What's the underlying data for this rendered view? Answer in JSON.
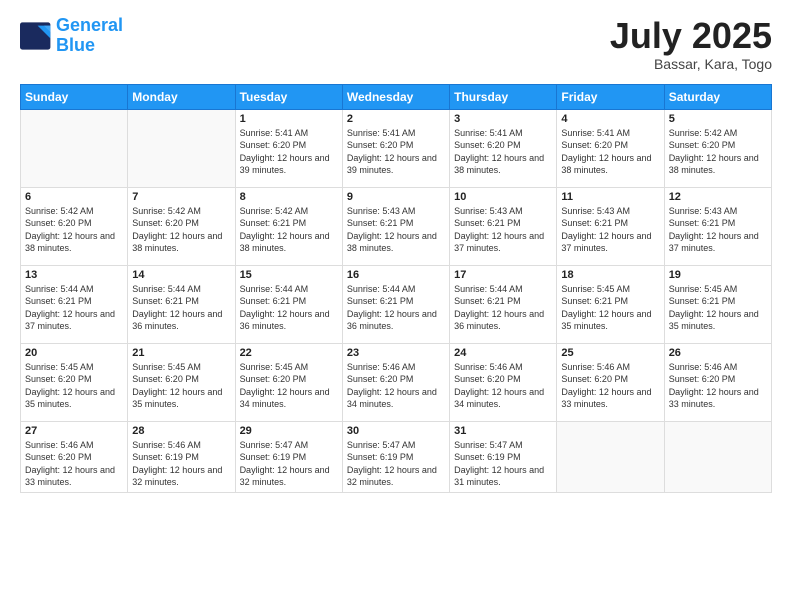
{
  "logo": {
    "line1": "General",
    "line2": "Blue"
  },
  "header": {
    "month": "July 2025",
    "location": "Bassar, Kara, Togo"
  },
  "weekdays": [
    "Sunday",
    "Monday",
    "Tuesday",
    "Wednesday",
    "Thursday",
    "Friday",
    "Saturday"
  ],
  "weeks": [
    [
      {
        "day": "",
        "info": ""
      },
      {
        "day": "",
        "info": ""
      },
      {
        "day": "1",
        "info": "Sunrise: 5:41 AM\nSunset: 6:20 PM\nDaylight: 12 hours and 39 minutes."
      },
      {
        "day": "2",
        "info": "Sunrise: 5:41 AM\nSunset: 6:20 PM\nDaylight: 12 hours and 39 minutes."
      },
      {
        "day": "3",
        "info": "Sunrise: 5:41 AM\nSunset: 6:20 PM\nDaylight: 12 hours and 38 minutes."
      },
      {
        "day": "4",
        "info": "Sunrise: 5:41 AM\nSunset: 6:20 PM\nDaylight: 12 hours and 38 minutes."
      },
      {
        "day": "5",
        "info": "Sunrise: 5:42 AM\nSunset: 6:20 PM\nDaylight: 12 hours and 38 minutes."
      }
    ],
    [
      {
        "day": "6",
        "info": "Sunrise: 5:42 AM\nSunset: 6:20 PM\nDaylight: 12 hours and 38 minutes."
      },
      {
        "day": "7",
        "info": "Sunrise: 5:42 AM\nSunset: 6:20 PM\nDaylight: 12 hours and 38 minutes."
      },
      {
        "day": "8",
        "info": "Sunrise: 5:42 AM\nSunset: 6:21 PM\nDaylight: 12 hours and 38 minutes."
      },
      {
        "day": "9",
        "info": "Sunrise: 5:43 AM\nSunset: 6:21 PM\nDaylight: 12 hours and 38 minutes."
      },
      {
        "day": "10",
        "info": "Sunrise: 5:43 AM\nSunset: 6:21 PM\nDaylight: 12 hours and 37 minutes."
      },
      {
        "day": "11",
        "info": "Sunrise: 5:43 AM\nSunset: 6:21 PM\nDaylight: 12 hours and 37 minutes."
      },
      {
        "day": "12",
        "info": "Sunrise: 5:43 AM\nSunset: 6:21 PM\nDaylight: 12 hours and 37 minutes."
      }
    ],
    [
      {
        "day": "13",
        "info": "Sunrise: 5:44 AM\nSunset: 6:21 PM\nDaylight: 12 hours and 37 minutes."
      },
      {
        "day": "14",
        "info": "Sunrise: 5:44 AM\nSunset: 6:21 PM\nDaylight: 12 hours and 36 minutes."
      },
      {
        "day": "15",
        "info": "Sunrise: 5:44 AM\nSunset: 6:21 PM\nDaylight: 12 hours and 36 minutes."
      },
      {
        "day": "16",
        "info": "Sunrise: 5:44 AM\nSunset: 6:21 PM\nDaylight: 12 hours and 36 minutes."
      },
      {
        "day": "17",
        "info": "Sunrise: 5:44 AM\nSunset: 6:21 PM\nDaylight: 12 hours and 36 minutes."
      },
      {
        "day": "18",
        "info": "Sunrise: 5:45 AM\nSunset: 6:21 PM\nDaylight: 12 hours and 35 minutes."
      },
      {
        "day": "19",
        "info": "Sunrise: 5:45 AM\nSunset: 6:21 PM\nDaylight: 12 hours and 35 minutes."
      }
    ],
    [
      {
        "day": "20",
        "info": "Sunrise: 5:45 AM\nSunset: 6:20 PM\nDaylight: 12 hours and 35 minutes."
      },
      {
        "day": "21",
        "info": "Sunrise: 5:45 AM\nSunset: 6:20 PM\nDaylight: 12 hours and 35 minutes."
      },
      {
        "day": "22",
        "info": "Sunrise: 5:45 AM\nSunset: 6:20 PM\nDaylight: 12 hours and 34 minutes."
      },
      {
        "day": "23",
        "info": "Sunrise: 5:46 AM\nSunset: 6:20 PM\nDaylight: 12 hours and 34 minutes."
      },
      {
        "day": "24",
        "info": "Sunrise: 5:46 AM\nSunset: 6:20 PM\nDaylight: 12 hours and 34 minutes."
      },
      {
        "day": "25",
        "info": "Sunrise: 5:46 AM\nSunset: 6:20 PM\nDaylight: 12 hours and 33 minutes."
      },
      {
        "day": "26",
        "info": "Sunrise: 5:46 AM\nSunset: 6:20 PM\nDaylight: 12 hours and 33 minutes."
      }
    ],
    [
      {
        "day": "27",
        "info": "Sunrise: 5:46 AM\nSunset: 6:20 PM\nDaylight: 12 hours and 33 minutes."
      },
      {
        "day": "28",
        "info": "Sunrise: 5:46 AM\nSunset: 6:19 PM\nDaylight: 12 hours and 32 minutes."
      },
      {
        "day": "29",
        "info": "Sunrise: 5:47 AM\nSunset: 6:19 PM\nDaylight: 12 hours and 32 minutes."
      },
      {
        "day": "30",
        "info": "Sunrise: 5:47 AM\nSunset: 6:19 PM\nDaylight: 12 hours and 32 minutes."
      },
      {
        "day": "31",
        "info": "Sunrise: 5:47 AM\nSunset: 6:19 PM\nDaylight: 12 hours and 31 minutes."
      },
      {
        "day": "",
        "info": ""
      },
      {
        "day": "",
        "info": ""
      }
    ]
  ]
}
